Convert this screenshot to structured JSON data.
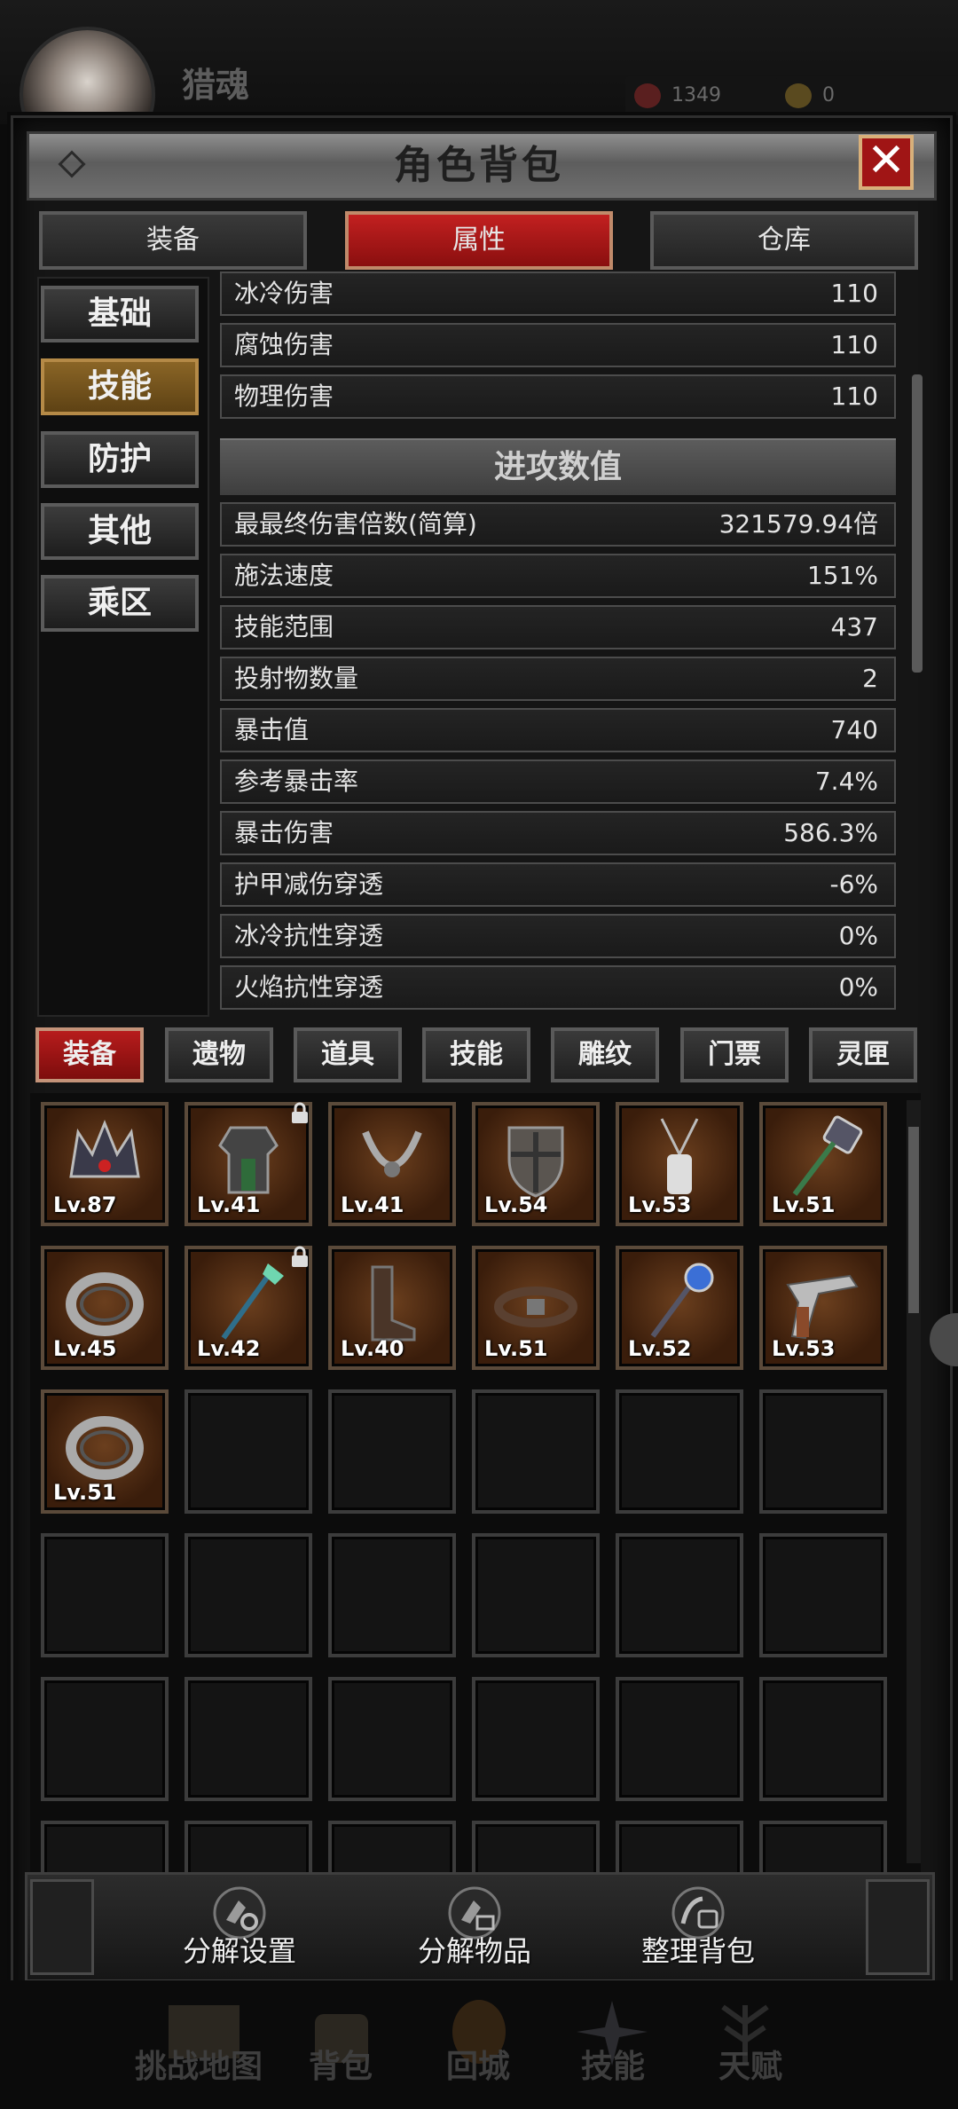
{
  "player": {
    "name": "猎魂",
    "gems": "1349",
    "coins": "0"
  },
  "window": {
    "title": "角色背包",
    "close_label": "✕"
  },
  "top_tabs": [
    "装备",
    "属性",
    "仓库"
  ],
  "side_tabs": [
    "基础",
    "技能",
    "防护",
    "其他",
    "乘区"
  ],
  "stats_top": [
    {
      "label": "冰冷伤害",
      "value": "110"
    },
    {
      "label": "腐蚀伤害",
      "value": "110"
    },
    {
      "label": "物理伤害",
      "value": "110"
    }
  ],
  "section_title": "进攻数值",
  "stats_attack": [
    {
      "label": "最最终伤害倍数(简算)",
      "value": "321579.94倍"
    },
    {
      "label": "施法速度",
      "value": "151%"
    },
    {
      "label": "技能范围",
      "value": "437"
    },
    {
      "label": "投射物数量",
      "value": "2"
    },
    {
      "label": "暴击值",
      "value": "740"
    },
    {
      "label": "参考暴击率",
      "value": "7.4%"
    },
    {
      "label": "暴击伤害",
      "value": "586.3%"
    },
    {
      "label": "护甲减伤穿透",
      "value": "-6%"
    },
    {
      "label": "冰冷抗性穿透",
      "value": "0%"
    },
    {
      "label": "火焰抗性穿透",
      "value": "0%"
    }
  ],
  "inventory_tabs": [
    "装备",
    "遗物",
    "道具",
    "技能",
    "雕纹",
    "门票",
    "灵匣"
  ],
  "items": [
    {
      "level": "Lv.87",
      "icon": "crown-icon",
      "locked": false
    },
    {
      "level": "Lv.41",
      "icon": "armor-icon",
      "locked": true
    },
    {
      "level": "Lv.41",
      "icon": "amulet-icon",
      "locked": false
    },
    {
      "level": "Lv.54",
      "icon": "shield-icon",
      "locked": false
    },
    {
      "level": "Lv.53",
      "icon": "necklace-icon",
      "locked": false
    },
    {
      "level": "Lv.51",
      "icon": "hammer-icon",
      "locked": false
    },
    {
      "level": "Lv.45",
      "icon": "ring-icon",
      "locked": false
    },
    {
      "level": "Lv.42",
      "icon": "staff-icon",
      "locked": true
    },
    {
      "level": "Lv.40",
      "icon": "boots-icon",
      "locked": false
    },
    {
      "level": "Lv.51",
      "icon": "belt-icon",
      "locked": false
    },
    {
      "level": "Lv.52",
      "icon": "scepter-icon",
      "locked": false
    },
    {
      "level": "Lv.53",
      "icon": "revolver-icon",
      "locked": false
    },
    {
      "level": "Lv.51",
      "icon": "ring-icon",
      "locked": false
    }
  ],
  "actions": [
    "分解设置",
    "分解物品",
    "整理背包"
  ],
  "bottom_nav": [
    "挑战地图",
    "背包",
    "回城",
    "技能",
    "天赋"
  ]
}
